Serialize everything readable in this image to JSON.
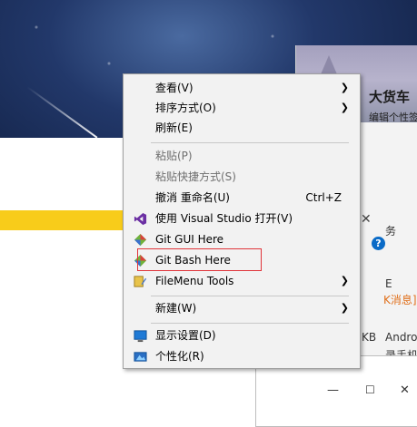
{
  "context_menu": {
    "items": [
      {
        "label": "查看(V)",
        "has_submenu": true
      },
      {
        "label": "排序方式(O)",
        "has_submenu": true
      },
      {
        "label": "刷新(E)"
      },
      {
        "label": "粘贴(P)",
        "disabled": true
      },
      {
        "label": "粘贴快捷方式(S)",
        "disabled": true
      },
      {
        "label": "撤消 重命名(U)",
        "shortcut": "Ctrl+Z"
      },
      {
        "label": "使用 Visual Studio 打开(V)",
        "icon": "visual-studio-icon"
      },
      {
        "label": "Git GUI Here",
        "icon": "git-icon"
      },
      {
        "label": "Git Bash Here",
        "icon": "git-icon",
        "highlighted": true
      },
      {
        "label": "FileMenu Tools",
        "icon": "filemenu-tools-icon",
        "has_submenu": true
      },
      {
        "label": "新建(W)",
        "has_submenu": true
      },
      {
        "label": "显示设置(D)",
        "icon": "display-settings-icon"
      },
      {
        "label": "个性化(R)",
        "icon": "personalize-icon"
      }
    ],
    "highlight_color": "#e0343a"
  },
  "right_window": {
    "title": "大货车",
    "subtitle": "编辑个性签名",
    "fragments": [
      "息",
      "务",
      "E",
      "K消息]",
      "Andro",
      "KB",
      "录手机"
    ],
    "help_icon": "help-icon",
    "close_icon": "close-icon"
  },
  "dialog": {
    "minimize_icon": "minimize-icon",
    "maximize_icon": "maximize-icon",
    "close_icon": "close-icon"
  },
  "colors": {
    "yellow_bar": "#f8cc1a",
    "menu_bg": "#f2f2f2",
    "link_orange": "#e0701c"
  }
}
